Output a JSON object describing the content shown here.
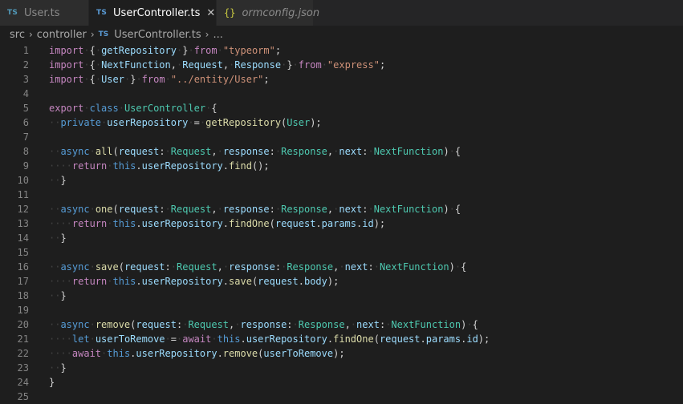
{
  "tabs": [
    {
      "label": "User.ts",
      "icon": "TS",
      "active": false
    },
    {
      "label": "UserController.ts",
      "icon": "TS",
      "active": true,
      "close": "✕"
    },
    {
      "label": "ormconfig.json",
      "icon": "{}",
      "active": false
    }
  ],
  "breadcrumb": {
    "items": [
      "src",
      "controller",
      "UserController.ts",
      "..."
    ],
    "ts_icon": "TS"
  },
  "editor": {
    "line_numbers": [
      "1",
      "2",
      "3",
      "4",
      "5",
      "6",
      "7",
      "8",
      "9",
      "10",
      "11",
      "12",
      "13",
      "14",
      "15",
      "16",
      "17",
      "18",
      "19",
      "20",
      "21",
      "22",
      "23",
      "24",
      "25"
    ],
    "lines": [
      "import { getRepository } from \"typeorm\";",
      "import { NextFunction, Request, Response } from \"express\";",
      "import { User } from \"../entity/User\";",
      "",
      "export class UserController {",
      "  private userRepository = getRepository(User);",
      "",
      "  async all(request: Request, response: Response, next: NextFunction) {",
      "    return this.userRepository.find();",
      "  }",
      "",
      "  async one(request: Request, response: Response, next: NextFunction) {",
      "    return this.userRepository.findOne(request.params.id);",
      "  }",
      "",
      "  async save(request: Request, response: Response, next: NextFunction) {",
      "    return this.userRepository.save(request.body);",
      "  }",
      "",
      "  async remove(request: Request, response: Response, next: NextFunction) {",
      "    let userToRemove = await this.userRepository.findOne(request.params.id);",
      "    await this.userRepository.remove(userToRemove);",
      "  }",
      "}",
      ""
    ]
  },
  "colors": {
    "keyword": "#569cd6",
    "control": "#c586c0",
    "function": "#dcdcaa",
    "type": "#4ec9b0",
    "variable": "#9cdcfe",
    "string": "#ce9178",
    "background": "#1e1e1e"
  }
}
